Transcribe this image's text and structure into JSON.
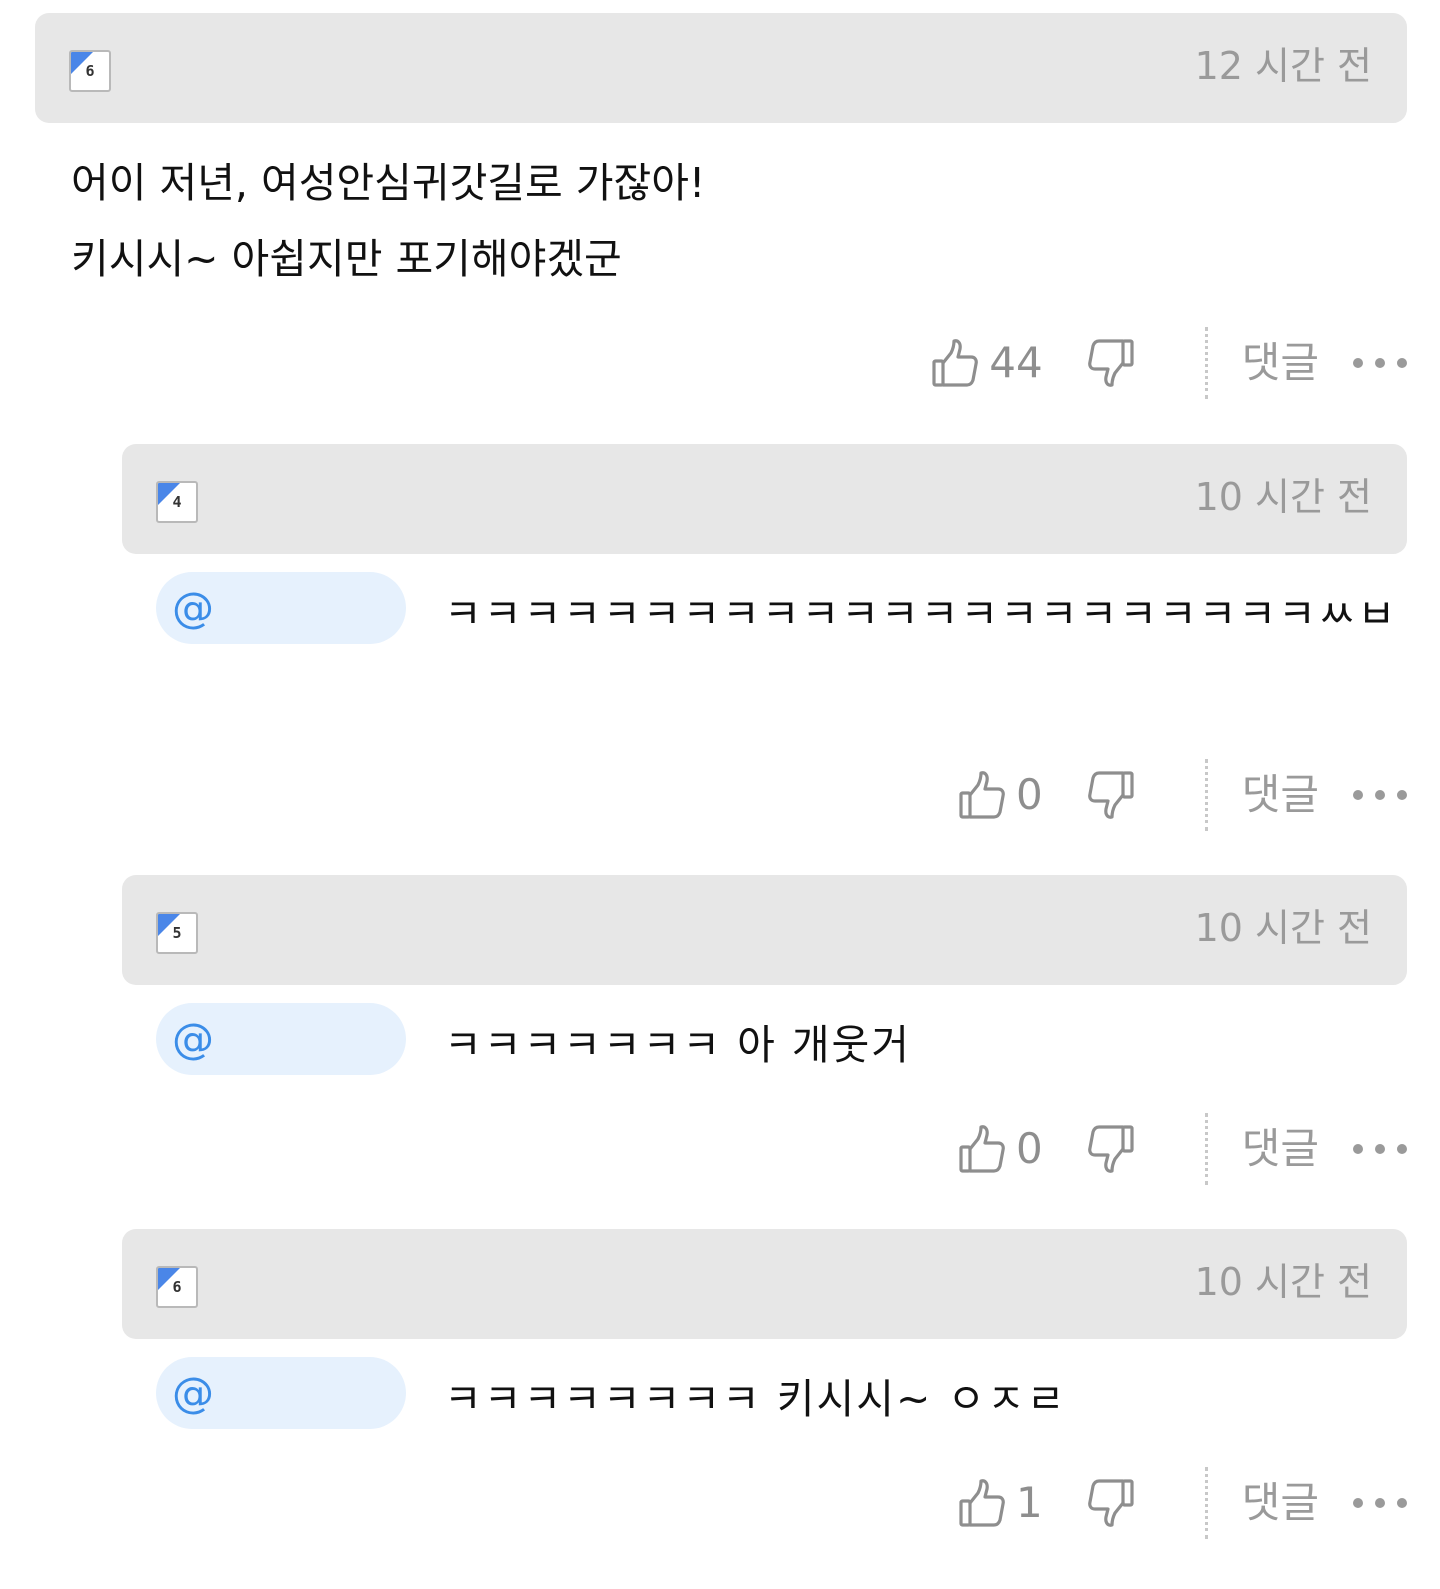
{
  "comments": [
    {
      "level": "6",
      "time": "12 시간 전",
      "text": "어이 저년, 여성안심귀갓길로 가잖아!\n키시시~ 아쉽지만 포기해야겠군",
      "likes": "44",
      "reply_label": "댓글"
    },
    {
      "level": "4",
      "time": "10 시간 전",
      "mention": "@",
      "text": "ㅋㅋㅋㅋㅋㅋㅋㅋㅋㅋㅋㅋㅋㅋㅋㅋㅋㅋㅋㅋㅋㅋㅆㅂ",
      "likes": "0",
      "reply_label": "댓글"
    },
    {
      "level": "5",
      "time": "10 시간 전",
      "mention": "@",
      "text": "ㅋㅋㅋㅋㅋㅋㅋ 아 개웃거",
      "likes": "0",
      "reply_label": "댓글"
    },
    {
      "level": "6",
      "time": "10 시간 전",
      "mention": "@",
      "text": "ㅋㅋㅋㅋㅋㅋㅋㅋ 키시시~ ㅇㅈㄹ",
      "likes": "1",
      "reply_label": "댓글"
    }
  ],
  "colors": {
    "header_bg": "#e7e7e7",
    "mention_bg": "#e6f1fd",
    "mention_text": "#3b8de8",
    "badge_corner": "#4a86e8",
    "meta_text": "#9a9a9a"
  },
  "icons": [
    "thumbs-up-icon",
    "thumbs-down-icon",
    "more-icon"
  ]
}
